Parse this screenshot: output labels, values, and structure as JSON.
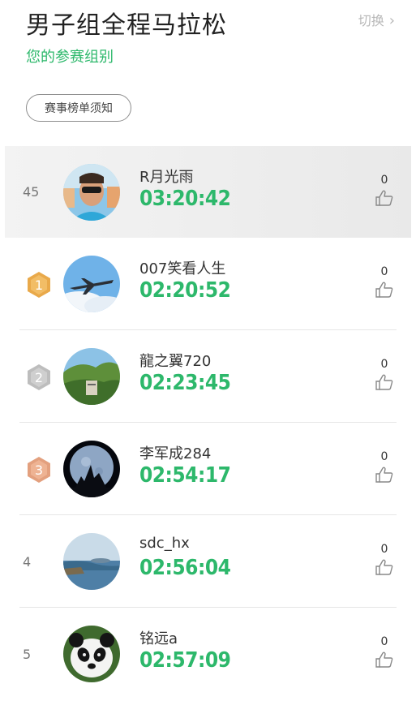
{
  "header": {
    "title": "男子组全程马拉松",
    "switch_label": "切换",
    "subtitle": "您的参赛组别",
    "notice_button": "赛事榜单须知"
  },
  "my_entry": {
    "rank": "45",
    "name": "R月光雨",
    "time": "03:20:42",
    "likes": "0"
  },
  "leaderboard": [
    {
      "rank": "1",
      "medal": "gold",
      "name": "007笑看人生",
      "time": "02:20:52",
      "likes": "0"
    },
    {
      "rank": "2",
      "medal": "silver",
      "name": "龍之翼720",
      "time": "02:23:45",
      "likes": "0"
    },
    {
      "rank": "3",
      "medal": "bronze",
      "name": "李军成284",
      "time": "02:54:17",
      "likes": "0"
    },
    {
      "rank": "4",
      "medal": "",
      "name": "sdc_hx",
      "time": "02:56:04",
      "likes": "0"
    },
    {
      "rank": "5",
      "medal": "",
      "name": "铭远a",
      "time": "02:57:09",
      "likes": "0"
    }
  ],
  "colors": {
    "accent_green": "#2db86b",
    "gold_medal": "#e9a94a",
    "silver_medal": "#bdbdbd",
    "bronze_medal": "#e3a07e"
  },
  "icons": {
    "like": "thumbs-up-icon",
    "switch": "chevron-right-icon"
  }
}
